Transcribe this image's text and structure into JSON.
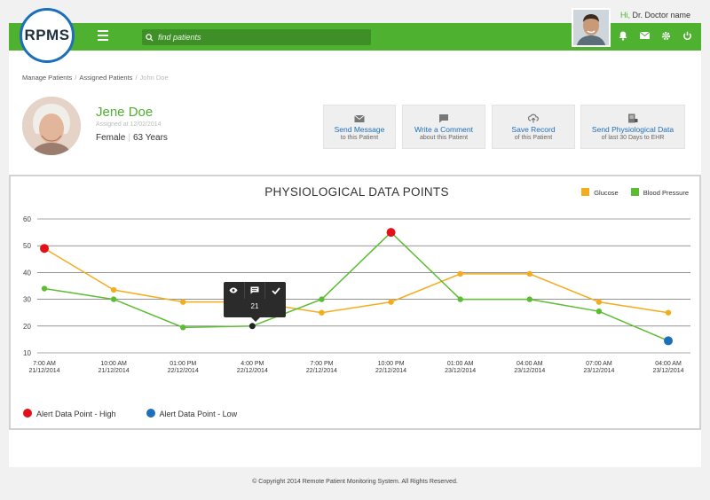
{
  "app": {
    "logo": "RPMS"
  },
  "search": {
    "placeholder": "find patients"
  },
  "user": {
    "greeting": "Hi,",
    "name": "Dr. Doctor name"
  },
  "breadcrumb": [
    "Manage Patients",
    "Assigned Patients",
    "John Doe"
  ],
  "patient": {
    "name": "Jene Doe",
    "assigned": "Assigned at 12/02/2014",
    "gender": "Female",
    "age": "63 Years"
  },
  "actions": [
    {
      "title": "Send Message",
      "sub": "to this Patient",
      "icon": "mail-icon"
    },
    {
      "title": "Write a Comment",
      "sub": "about this Patient",
      "icon": "comment-icon"
    },
    {
      "title": "Save Record",
      "sub": "of this Patient",
      "icon": "cloud-upload-icon"
    },
    {
      "title": "Send Physiological Data",
      "sub": "of last 30 Days to EHR",
      "icon": "document-icon"
    }
  ],
  "colors": {
    "brand_green": "#4eb12f",
    "brand_blue": "#1c6fb9",
    "glucose": "#f4ac1f",
    "bp": "#5cbc32",
    "alert_high": "#e3101a",
    "alert_low": "#1c6fb9"
  },
  "chart_data": {
    "type": "line",
    "title": "PHYSIOLOGICAL DATA POINTS",
    "categories": [
      [
        "7:00 AM",
        "21/12/2014"
      ],
      [
        "10:00 AM",
        "21/12/2014"
      ],
      [
        "01:00 PM",
        "22/12/2014"
      ],
      [
        "4:00 PM",
        "22/12/2014"
      ],
      [
        "7:00 PM",
        "22/12/2014"
      ],
      [
        "10:00 PM",
        "22/12/2014"
      ],
      [
        "01:00 AM",
        "23/12/2014"
      ],
      [
        "04:00 AM",
        "23/12/2014"
      ],
      [
        "07:00 AM",
        "23/12/2014"
      ],
      [
        "04:00 AM",
        "23/12/2014"
      ]
    ],
    "yticks": [
      10,
      20,
      30,
      40,
      50,
      60
    ],
    "ylim": [
      10,
      60
    ],
    "series": [
      {
        "name": "Glucose",
        "color": "#f4ac1f",
        "values": [
          49,
          33.5,
          29,
          29,
          25,
          29,
          39.5,
          39.5,
          29,
          25
        ]
      },
      {
        "name": "Blood Pressure",
        "color": "#5cbc32",
        "values": [
          34,
          30,
          19.5,
          20,
          30,
          55,
          30,
          30,
          25.5,
          14.5
        ]
      }
    ],
    "alerts_high": [
      {
        "series": 0,
        "index": 0
      },
      {
        "series": 1,
        "index": 5
      }
    ],
    "alerts_low": [
      {
        "series": 1,
        "index": 9
      }
    ],
    "highlight": {
      "series": 1,
      "index": 3,
      "value": "21"
    },
    "alert_legend": {
      "high": "Alert Data Point - High",
      "low": "Alert Data Point - Low"
    },
    "grid": true,
    "legend_position": "top-right"
  },
  "footer": "© Copyright 2014 Remote Patient Monitoring System. All Rights Reserved."
}
